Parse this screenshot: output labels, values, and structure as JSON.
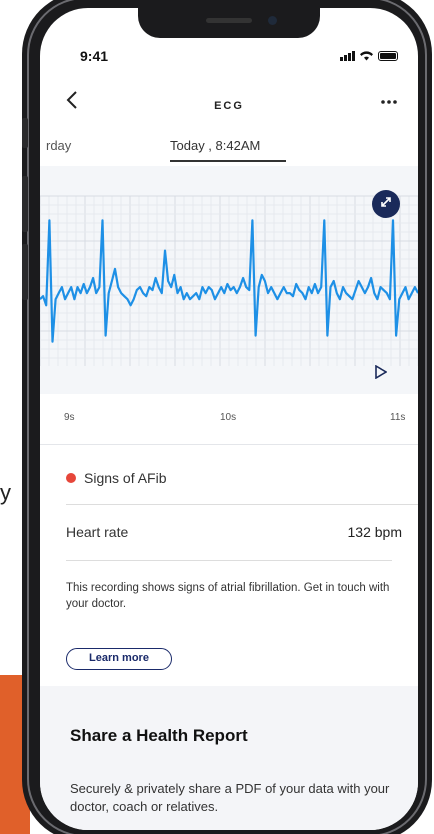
{
  "status": {
    "time": "9:41"
  },
  "nav": {
    "back_icon": "chevron-left-icon",
    "title": "ECG",
    "more_icon": "more-horizontal-icon"
  },
  "tabs": {
    "previous": "rday",
    "current": "Today , 8:42AM"
  },
  "chart_data": {
    "type": "line",
    "x_ticks": [
      "9s",
      "10s",
      "11s"
    ],
    "x": [
      8.6,
      8.62,
      8.64,
      8.66,
      8.68,
      8.7,
      8.72,
      8.74,
      8.76,
      8.78,
      8.8,
      8.82,
      8.84,
      8.86,
      8.88,
      8.9,
      8.92,
      8.94,
      8.96,
      8.98,
      9.0,
      9.02,
      9.04,
      9.06,
      9.08,
      9.1,
      9.12,
      9.14,
      9.16,
      9.18,
      9.2,
      9.22,
      9.24,
      9.26,
      9.28,
      9.3,
      9.32,
      9.34,
      9.36,
      9.38,
      9.4,
      9.42,
      9.44,
      9.46,
      9.48,
      9.5,
      9.52,
      9.54,
      9.56,
      9.58,
      9.6,
      9.62,
      9.64,
      9.66,
      9.68,
      9.7,
      9.72,
      9.74,
      9.76,
      9.78,
      9.8,
      9.82,
      9.84,
      9.86,
      9.88,
      9.9,
      9.92,
      9.94,
      9.96,
      9.98,
      10.0,
      10.02,
      10.04,
      10.06,
      10.08,
      10.1,
      10.12,
      10.14,
      10.16,
      10.18,
      10.2,
      10.22,
      10.24,
      10.26,
      10.28,
      10.3,
      10.32,
      10.34,
      10.36,
      10.38,
      10.4,
      10.42,
      10.44,
      10.46,
      10.48,
      10.5,
      10.52,
      10.54,
      10.56,
      10.58,
      10.6,
      10.62,
      10.64,
      10.66,
      10.68,
      10.7,
      10.72,
      10.74,
      10.76,
      10.78,
      10.8,
      10.82,
      10.84,
      10.86,
      10.88,
      10.9,
      10.92,
      10.94,
      10.96,
      10.98,
      11.0,
      11.02
    ],
    "y": [
      0.1,
      0.15,
      0.0,
      1.4,
      -0.6,
      0.1,
      0.2,
      0.3,
      0.1,
      0.2,
      0.3,
      0.1,
      0.3,
      0.2,
      0.35,
      0.2,
      0.3,
      0.45,
      0.2,
      0.3,
      1.4,
      -0.5,
      0.2,
      0.4,
      0.6,
      0.3,
      0.2,
      0.15,
      0.1,
      0.0,
      0.1,
      0.25,
      0.3,
      0.2,
      0.15,
      0.3,
      0.25,
      0.45,
      0.3,
      0.2,
      0.9,
      0.4,
      0.3,
      0.5,
      0.2,
      0.3,
      0.1,
      0.2,
      0.1,
      0.15,
      0.2,
      0.1,
      0.3,
      0.2,
      0.3,
      0.25,
      0.1,
      0.2,
      0.3,
      0.2,
      0.35,
      0.25,
      0.3,
      0.2,
      0.3,
      0.45,
      0.3,
      0.25,
      1.4,
      -0.5,
      0.3,
      0.5,
      0.4,
      0.2,
      0.3,
      0.2,
      0.1,
      0.2,
      0.3,
      0.2,
      0.2,
      0.15,
      0.35,
      0.25,
      0.2,
      0.1,
      0.3,
      0.2,
      0.35,
      0.2,
      0.3,
      1.4,
      -0.5,
      0.3,
      0.4,
      0.2,
      0.1,
      0.3,
      0.2,
      0.15,
      0.1,
      0.25,
      0.4,
      0.3,
      0.2,
      0.3,
      0.45,
      0.2,
      0.1,
      0.3,
      0.25,
      0.2,
      0.1,
      1.4,
      -0.5,
      0.1,
      0.2,
      0.3,
      0.1,
      0.2,
      0.3,
      0.2
    ],
    "xlim": [
      8.6,
      11.02
    ],
    "ylim": [
      -1.0,
      1.8
    ],
    "grid": true,
    "color": "#1e90e6"
  },
  "controls": {
    "expand_icon": "expand-arrows-icon",
    "play_icon": "play-icon"
  },
  "result": {
    "afib_label": "Signs of AFib",
    "afib_color": "#e6463a",
    "heart_rate_label": "Heart rate",
    "heart_rate_value": "132 bpm",
    "note": "This recording shows signs of atrial fibrillation. Get in touch with your doctor.",
    "learn_more": "Learn more"
  },
  "share": {
    "title": "Share a Health Report",
    "text": "Securely & privately share a PDF of your data with your doctor, coach or relatives."
  },
  "background": {
    "partial_letter": "y",
    "accent_color": "#e0602a"
  }
}
